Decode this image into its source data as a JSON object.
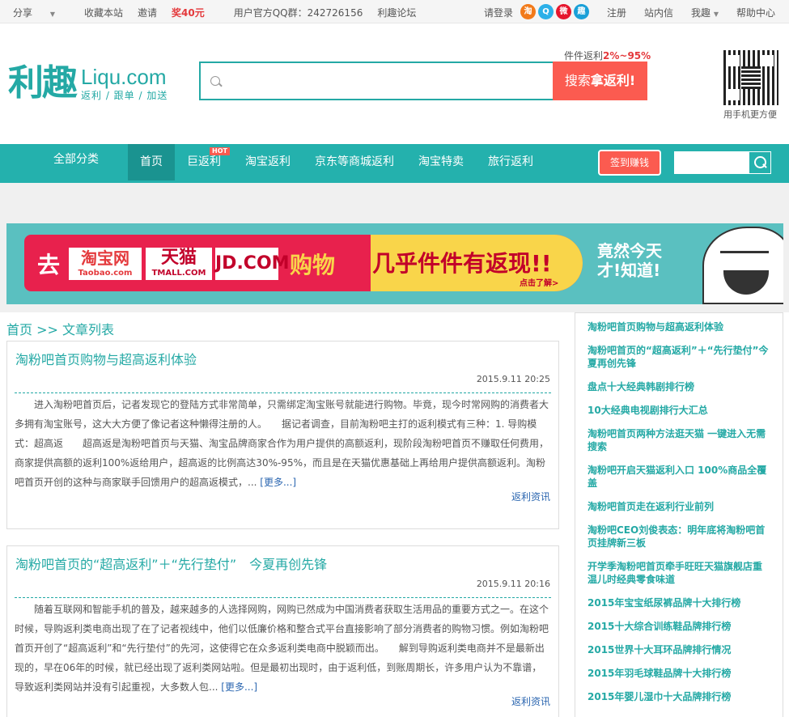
{
  "topbar": {
    "share": "分享",
    "favorite": "收藏本站",
    "invite_prefix": "邀请",
    "invite_reward": "奖40元",
    "qq_group": "用户官方QQ群：242726156",
    "forum": "利趣论坛",
    "login": "请登录",
    "social_icons": [
      "taobao-icon",
      "qq-icon",
      "weibo-icon",
      "qzone-icon"
    ],
    "social_glyphs": [
      "淘",
      "Q",
      "微",
      "趣"
    ],
    "register": "注册",
    "inbox": "站内信",
    "my_account": "我趣",
    "help": "帮助中心"
  },
  "header": {
    "logo_cn": "利趣",
    "logo_domain": "Liqu.com",
    "logo_slogan": "返利 / 跟单 / 加送",
    "rebate_label": "件件返利",
    "rebate_range": "2%~95%",
    "search_placeholder": "",
    "search_button_prefix": "搜索",
    "search_button_bold": "拿返利",
    "search_button_suffix": "!",
    "qr_caption": "用手机更方便"
  },
  "nav": {
    "all_categories": "全部分类",
    "items": [
      {
        "label": "首页",
        "active": true
      },
      {
        "label": "巨返利",
        "hot": "HOT"
      },
      {
        "label": "淘宝返利"
      },
      {
        "label": "京东等商城返利"
      },
      {
        "label": "淘宝特卖"
      },
      {
        "label": "旅行返利"
      }
    ],
    "sign_in_button": "签到赚钱"
  },
  "banner": {
    "go": "去",
    "taobao": "淘宝网",
    "taobao_sub": "Taobao.com",
    "tmall": "天猫",
    "tmall_sub": "TMALL.COM",
    "jd": "JD.COM",
    "shopping": "购物",
    "slogan": "几乎件件有返现!!",
    "more": "点击了解>",
    "wow_line1": "竟然今天",
    "wow_line2": "才!知道!"
  },
  "breadcrumb": "首页 >> 文章列表",
  "articles": [
    {
      "title": "淘粉吧首页购物与超高返利体验",
      "time": "2015.9.11 20:25",
      "body": "进入淘粉吧首页后，记者发现它的登陆方式非常简单，只需绑定淘宝账号就能进行购物。毕竟，现今时常网购的消费者大多拥有淘宝账号，这大大方便了像记者这种懒得注册的人。　　据记者调查，目前淘粉吧主打的返利模式有三种：1. 导购模式：超高返　　超高返是淘粉吧首页与天猫、淘宝品牌商家合作为用户提供的高额返利，现阶段淘粉吧首页不赚取任何费用，商家提供高额的返利100%返给用户，超高返的比例高达30%-95%，而且是在天猫优惠基础上再给用户提供高额返利。淘粉吧首页开创的这种与商家联手回馈用户的超高返模式，...",
      "more": "[更多...]",
      "tag": "返利资讯"
    },
    {
      "title": "淘粉吧首页的“超高返利”＋“先行垫付”　今夏再创先锋",
      "time": "2015.9.11 20:16",
      "body": "随着互联网和智能手机的普及，越来越多的人选择网购，网购已然成为中国消费者获取生活用品的重要方式之一。在这个时候，导购返利类电商出现了在了记者视线中，他们以低廉价格和整合式平台直接影响了部分消费者的购物习惯。例如淘粉吧首页开创了“超高返利”和“先行垫付”的先河，这使得它在众多返利类电商中脱颖而出。　　解到导购返利类电商并不是最新出现的，早在06年的时候，就已经出现了返利类网站啦。但是最初出现时，由于返利低，到账周期长，许多用户认为不靠谱，导致返利类网站并没有引起重视，大多数人包...",
      "more": "[更多...]",
      "tag": "返利资讯"
    }
  ],
  "sidebar": [
    "淘粉吧首页购物与超高返利体验",
    "淘粉吧首页的“超高返利”＋“先行垫付”今夏再创先锋",
    "盘点十大经典韩剧排行榜",
    "10大经典电视剧排行大汇总",
    "淘粉吧首页两种方法逛天猫 一键进入无需搜索",
    "淘粉吧开启天猫返利入口 100%商品全覆盖",
    "淘粉吧首页走在返利行业前列",
    "淘粉吧CEO刘俊表态：明年底将淘粉吧首页挂牌新三板",
    "开学季淘粉吧首页牵手旺旺天猫旗舰店重温儿时经典零食味道",
    "2015年宝宝纸尿裤品牌十大排行榜",
    "2015十大综合训练鞋品牌排行榜",
    "2015世界十大耳环品牌排行情况",
    "2015年羽毛球鞋品牌十大排行榜",
    "2015年婴儿湿巾十大品牌排行榜"
  ],
  "colors": {
    "accent": "#24a9a5",
    "nav": "#24b1ad",
    "red": "#fb5b50"
  }
}
